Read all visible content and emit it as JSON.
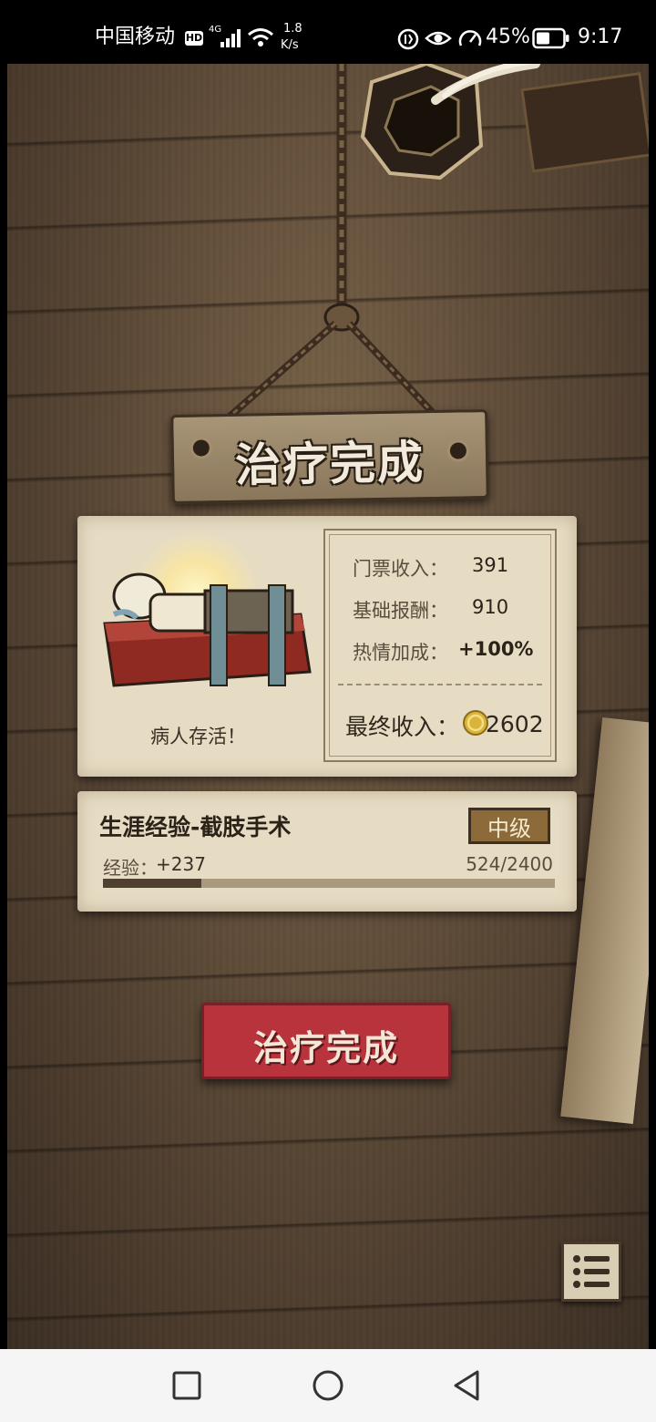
{
  "status_bar": {
    "carrier": "中国移动",
    "hd_badge": "HD",
    "network_type": "4G",
    "net_speed_value": "1.8",
    "net_speed_unit": "K/s",
    "battery": "45%",
    "time": "9:17"
  },
  "header_sign": {
    "title": "治疗完成"
  },
  "result_panel": {
    "patient_status": "病人存活！",
    "rows": [
      {
        "label": "门票收入：",
        "value": "391"
      },
      {
        "label": "基础报酬：",
        "value": "910"
      },
      {
        "label": "热情加成：",
        "value": "+100%"
      }
    ],
    "final_label": "最终收入：",
    "final_value": "2602"
  },
  "experience_panel": {
    "title": "生涯经验-截肢手术",
    "level_badge": "中级",
    "exp_label": "经验：",
    "exp_gain": "+237",
    "progress_text": "524/2400",
    "progress_current": 524,
    "progress_max": 2400
  },
  "complete_button": {
    "label": "治疗完成"
  },
  "icons": {
    "menu": "list-icon",
    "coin": "coin-icon"
  },
  "colors": {
    "button_red": "#b8333b",
    "badge_brown": "#8c6a3a",
    "panel_paper": "#e6dcc4"
  },
  "nav_bar": {
    "back": "back-icon",
    "home": "home-icon",
    "recents": "recents-icon"
  }
}
